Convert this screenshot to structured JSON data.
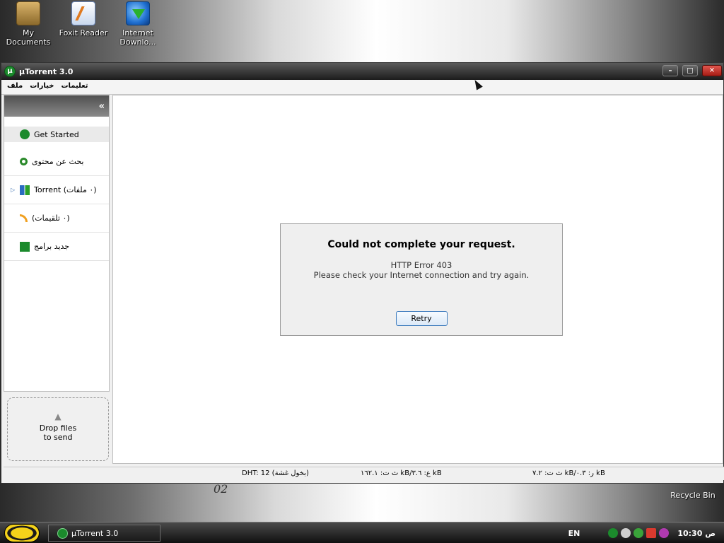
{
  "desktop": {
    "icons": [
      {
        "label": "My Documents"
      },
      {
        "label": "Foxit Reader"
      },
      {
        "label": "Internet Downlo..."
      }
    ],
    "recycle_bin": "Recycle Bin",
    "deco_text": "02"
  },
  "window": {
    "title": "µTorrent 3.0",
    "menu": [
      "ملف",
      "خيارات",
      "تعليمات"
    ],
    "sidebar": {
      "items": [
        {
          "label": "Get Started",
          "icon": "utorrent-icon"
        },
        {
          "label": "بحث عن محتوى",
          "icon": "search-icon"
        },
        {
          "label": "Torrent (٠ ملفات)",
          "icon": "torrent-icon"
        },
        {
          "label": "(٠ تلقيمات)",
          "icon": "feed-icon"
        },
        {
          "label": "جديد برامج",
          "icon": "apps-icon"
        }
      ],
      "dropzone": {
        "line1": "Drop files",
        "line2": "to send"
      }
    },
    "error": {
      "heading": "Could not complete your request.",
      "code": "HTTP Error 403",
      "detail": "Please check your Internet connection and try again.",
      "retry_label": "Retry"
    },
    "status": {
      "dht": "DHT: 12 (بخول غشة)",
      "download": "ث ت: ١٦٢.١ kB/ع: ٣.٦ kB",
      "upload": "ث ت: ٧.٢ kB/ر: ٠.٣ kB"
    }
  },
  "taskbar": {
    "task_label": "µTorrent 3.0",
    "lang": "EN",
    "clock": "10:30 ص"
  }
}
